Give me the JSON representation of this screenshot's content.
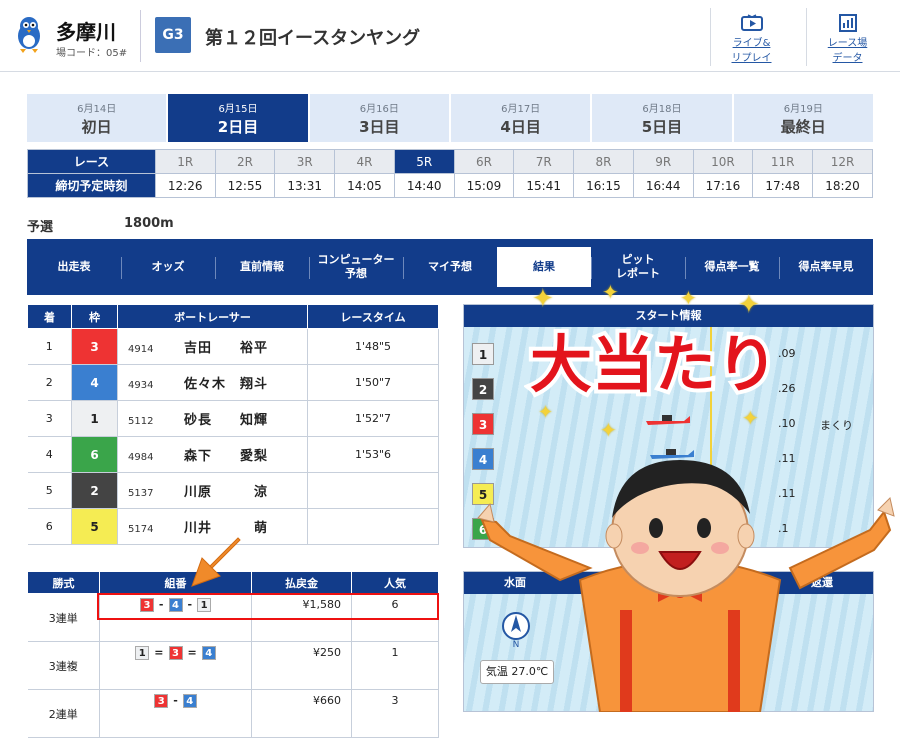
{
  "header": {
    "venue_name": "多摩川",
    "venue_code": "場コード：05#",
    "grade": "G3",
    "race_title": "第１２回イースタンヤング",
    "live_btn": "ライブ&\nリプレイ",
    "data_btn": "レース場\nデータ"
  },
  "day_tabs": [
    {
      "date": "6月14日",
      "label": "初日"
    },
    {
      "date": "6月15日",
      "label": "2日目"
    },
    {
      "date": "6月16日",
      "label": "3日目"
    },
    {
      "date": "6月17日",
      "label": "4日目"
    },
    {
      "date": "6月18日",
      "label": "5日目"
    },
    {
      "date": "6月19日",
      "label": "最終日"
    }
  ],
  "race_table": {
    "race_label": "レース",
    "time_label": "締切予定時刻",
    "races": [
      "1R",
      "2R",
      "3R",
      "4R",
      "5R",
      "6R",
      "7R",
      "8R",
      "9R",
      "10R",
      "11R",
      "12R"
    ],
    "times": [
      "12:26",
      "12:55",
      "13:31",
      "14:05",
      "14:40",
      "15:09",
      "15:41",
      "16:15",
      "16:44",
      "17:16",
      "17:48",
      "18:20"
    ],
    "active_index": 4
  },
  "race_info": {
    "class": "予選",
    "distance": "1800m"
  },
  "nav": [
    "出走表",
    "オッズ",
    "直前情報",
    "コンピューター\n予想",
    "マイ予想",
    "結果",
    "ピット\nレポート",
    "得点率一覧",
    "得点率早見"
  ],
  "results": {
    "headers": [
      "着",
      "枠",
      "ボートレーサー",
      "レースタイム"
    ],
    "rows": [
      {
        "rank": "1",
        "waku": "3",
        "no": "4914",
        "name": "吉田　　裕平",
        "time": "1'48\"5"
      },
      {
        "rank": "2",
        "waku": "4",
        "no": "4934",
        "name": "佐々木　翔斗",
        "time": "1'50\"7"
      },
      {
        "rank": "3",
        "waku": "1",
        "no": "5112",
        "name": "砂長　　知輝",
        "time": "1'52\"7"
      },
      {
        "rank": "4",
        "waku": "6",
        "no": "4984",
        "name": "森下　　愛梨",
        "time": "1'53\"6"
      },
      {
        "rank": "5",
        "waku": "2",
        "no": "5137",
        "name": "川原　　　涼",
        "time": ""
      },
      {
        "rank": "6",
        "waku": "5",
        "no": "5174",
        "name": "川井　　　萌",
        "time": ""
      }
    ]
  },
  "start_info": {
    "title": "スタート情報",
    "rows": [
      {
        "waku": "1",
        "time": ".09",
        "note": ""
      },
      {
        "waku": "2",
        "time": ".26",
        "note": ""
      },
      {
        "waku": "3",
        "time": ".10",
        "note": "まくり"
      },
      {
        "waku": "4",
        "time": ".11",
        "note": ""
      },
      {
        "waku": "5",
        "time": ".11",
        "note": ""
      },
      {
        "waku": "6",
        "time": ".1",
        "note": ""
      }
    ]
  },
  "payout": {
    "headers": [
      "勝式",
      "組番",
      "払戻金",
      "人気"
    ],
    "rows": [
      {
        "type": "3連単",
        "combo": [
          "3",
          "4",
          "1"
        ],
        "sep": [
          "-",
          "-"
        ],
        "amount": "¥1,580",
        "pop": "6"
      },
      {
        "type": "3連複",
        "combo": [
          "1",
          "3",
          "4"
        ],
        "sep": [
          "=",
          "="
        ],
        "amount": "¥250",
        "pop": "1"
      },
      {
        "type": "2連単",
        "combo": [
          "3",
          "4"
        ],
        "sep": [
          "-"
        ],
        "amount": "¥660",
        "pop": "3"
      }
    ]
  },
  "water": {
    "title_left": "水面",
    "title_right": "返還",
    "compass": "N",
    "temp": "気温 27.0℃"
  },
  "overlay": {
    "big_text": "大当たり"
  },
  "colors": {
    "navy": "#123c8a",
    "waku1": "#eef0f2",
    "waku2": "#444444",
    "waku3": "#ee3333",
    "waku4": "#3a7fd0",
    "waku5": "#f5ec53",
    "waku6": "#3aa54a"
  }
}
